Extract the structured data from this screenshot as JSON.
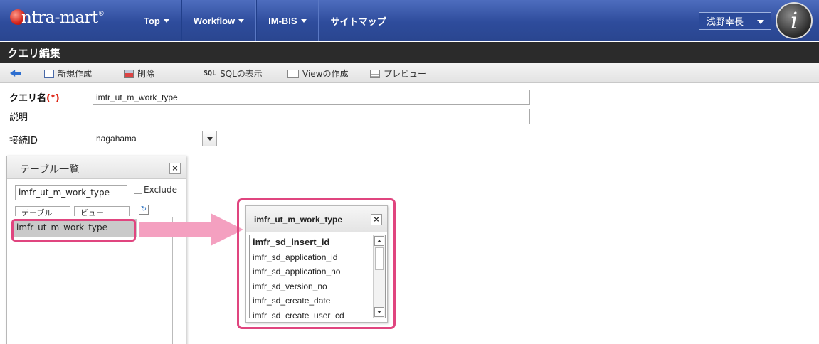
{
  "nav": {
    "logo": "ntra-mart",
    "logo_mark": "®",
    "items": [
      {
        "label": "Top",
        "dropdown": true
      },
      {
        "label": "Workflow",
        "dropdown": true
      },
      {
        "label": "IM-BIS",
        "dropdown": true
      },
      {
        "label": "サイトマップ",
        "dropdown": false
      }
    ],
    "user": "浅野幸長",
    "avatar_glyph": "i"
  },
  "page": {
    "title": "クエリ編集"
  },
  "toolbar": {
    "new_label": "新規作成",
    "delete_label": "削除",
    "sql_prefix": "SQL",
    "sql_label": "SQLの表示",
    "view_label": "Viewの作成",
    "preview_label": "プレビュー"
  },
  "form": {
    "query_name_label": "クエリ名",
    "required_mark": "(*)",
    "query_name_value": "imfr_ut_m_work_type",
    "description_label": "説明",
    "description_value": "",
    "connection_label": "接続ID",
    "connection_value": "nagahama"
  },
  "table_panel": {
    "title": "テーブル一覧",
    "close": "×",
    "filter_value": "imfr_ut_m_work_type",
    "exclude_label": "Exclude",
    "tabs": [
      "テーブル",
      "ビュー"
    ],
    "refresh_glyph": "↻",
    "selected_item": "imfr_ut_m_work_type"
  },
  "column_panel": {
    "title": "imfr_ut_m_work_type",
    "close": "×",
    "columns": [
      "imfr_sd_insert_id",
      "imfr_sd_application_id",
      "imfr_sd_application_no",
      "imfr_sd_version_no",
      "imfr_sd_create_date",
      "imfr_sd_create_user_cd"
    ]
  },
  "colors": {
    "nav_blue": "#2e4c9c",
    "title_dark": "#2b2b2b",
    "highlight_pink": "#e0457f",
    "arrow_pink": "#f4a0c0"
  }
}
